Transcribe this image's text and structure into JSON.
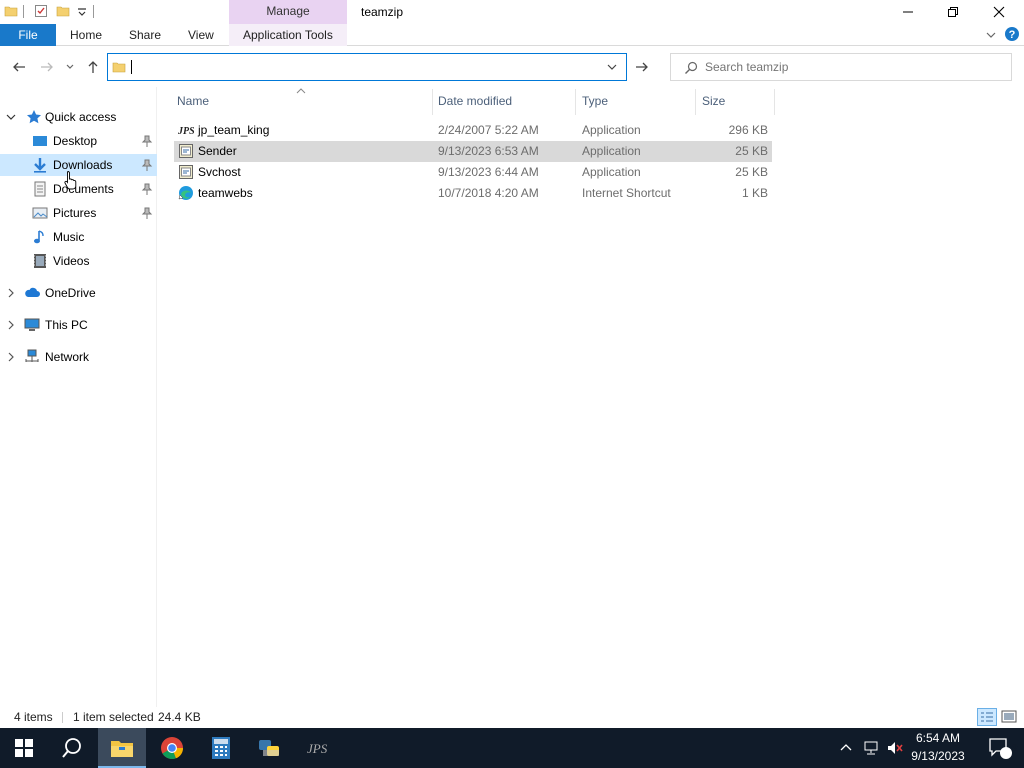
{
  "title_bar": {
    "manage_label": "Manage",
    "window_title": "teamzip"
  },
  "ribbon": {
    "file": "File",
    "home": "Home",
    "share": "Share",
    "view": "View",
    "application_tools": "Application Tools"
  },
  "address": {
    "value": ""
  },
  "search": {
    "placeholder": "Search teamzip"
  },
  "nav": {
    "quick_access": "Quick access",
    "desktop": "Desktop",
    "downloads": "Downloads",
    "documents": "Documents",
    "pictures": "Pictures",
    "music": "Music",
    "videos": "Videos",
    "onedrive": "OneDrive",
    "this_pc": "This PC",
    "network": "Network"
  },
  "columns": {
    "name": "Name",
    "date_modified": "Date modified",
    "type": "Type",
    "size": "Size"
  },
  "files": [
    {
      "name": "jp_team_king",
      "date": "2/24/2007 5:22 AM",
      "type": "Application",
      "size": "296 KB",
      "icon": "jps-app-icon"
    },
    {
      "name": "Sender",
      "date": "9/13/2023 6:53 AM",
      "type": "Application",
      "size": "25 KB",
      "icon": "exe-app-icon"
    },
    {
      "name": "Svchost",
      "date": "9/13/2023 6:44 AM",
      "type": "Application",
      "size": "25 KB",
      "icon": "exe-app-icon"
    },
    {
      "name": "teamwebs",
      "date": "10/7/2018 4:20 AM",
      "type": "Internet Shortcut",
      "size": "1 KB",
      "icon": "edge-shortcut-icon"
    }
  ],
  "status": {
    "items": "4 items",
    "selected": "1 item selected",
    "size": "24.4 KB"
  },
  "taskbar": {
    "time": "6:54 AM",
    "date": "9/13/2023",
    "notification_count": "2"
  },
  "colors": {
    "accent": "#0078d7",
    "file_tab": "#1979ca",
    "selection": "#cce8ff",
    "manage_tab": "#e9d3f2",
    "taskbar": "#101b29"
  }
}
